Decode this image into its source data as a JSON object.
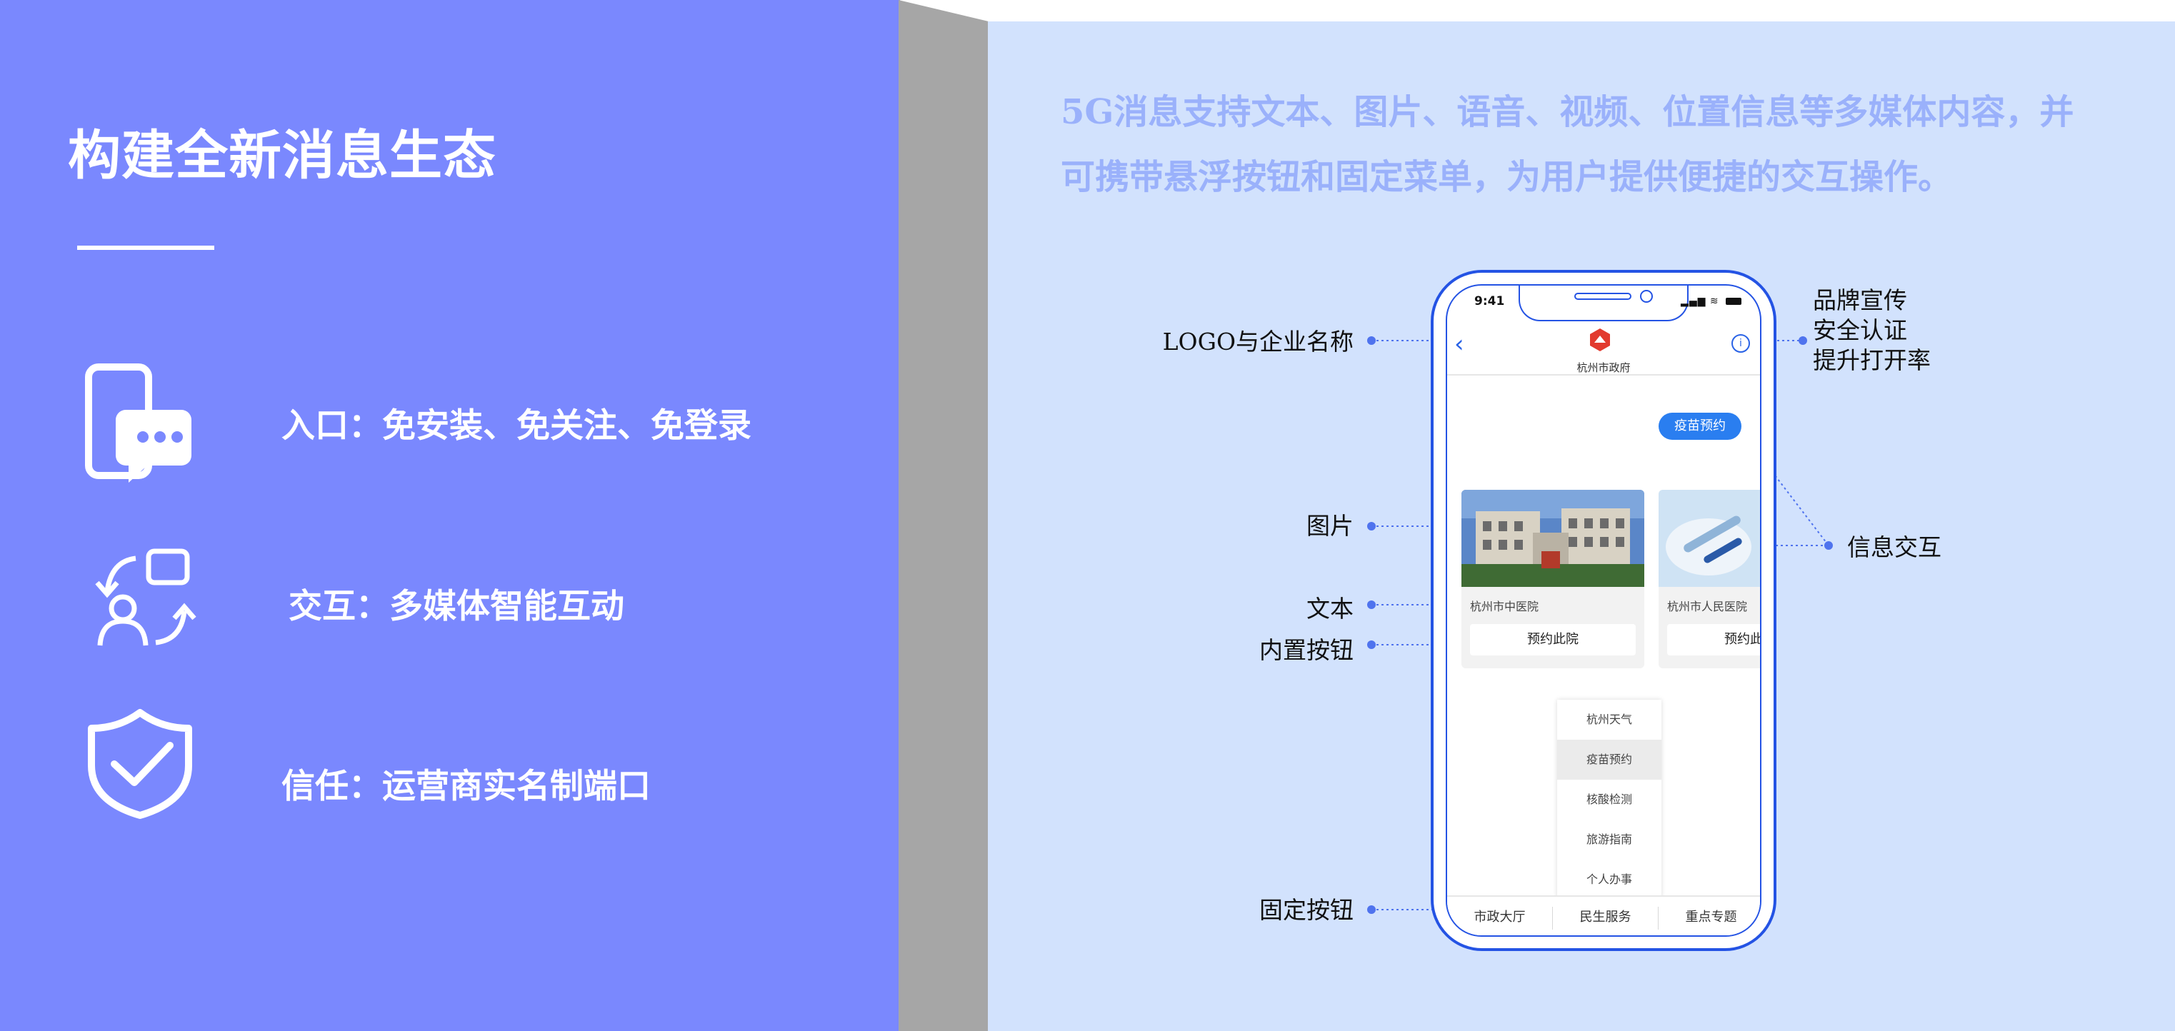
{
  "left_panel": {
    "title": "构建全新消息生态",
    "features": [
      {
        "icon": "phone-message-icon",
        "text": "入口：免安装、免关注、免登录"
      },
      {
        "icon": "user-interaction-icon",
        "text": "交互：多媒体智能互动"
      },
      {
        "icon": "shield-check-icon",
        "text": "信任：运营商实名制端口"
      }
    ]
  },
  "description": {
    "line1": "5G消息支持文本、图片、语音、视频、位置信息等多媒体内容，并",
    "line2": "可携带悬浮按钮和固定菜单，为用户提供便捷的交互操作。"
  },
  "annotations": {
    "logo": "LOGO与企业名称",
    "brand": [
      "品牌宣传",
      "安全认证",
      "提升打开率"
    ],
    "image": "图片",
    "text": "文本",
    "builtin_button": "内置按钮",
    "fixed_button": "固定按钮",
    "interaction": "信息交互"
  },
  "phone": {
    "time": "9:41",
    "org_name": "杭州市政府",
    "floating_chip": "疫苗预约",
    "cards": [
      {
        "name": "杭州市中医院",
        "button": "预约此院"
      },
      {
        "name": "杭州市人民医院",
        "button": "预约此院"
      }
    ],
    "menu_items": [
      "杭州天气",
      "疫苗预约",
      "核酸检测",
      "旅游指南",
      "个人办事"
    ],
    "menu_active": "疫苗预约",
    "bottom_tabs": [
      "市政大厅",
      "民生服务",
      "重点专题"
    ]
  },
  "colors": {
    "left_bg": "#7a88fe",
    "right_bg": "#d2e2fd",
    "fold": "#a6a6a6",
    "accent": "#2453e4",
    "description_text": "#9ab1fb"
  }
}
